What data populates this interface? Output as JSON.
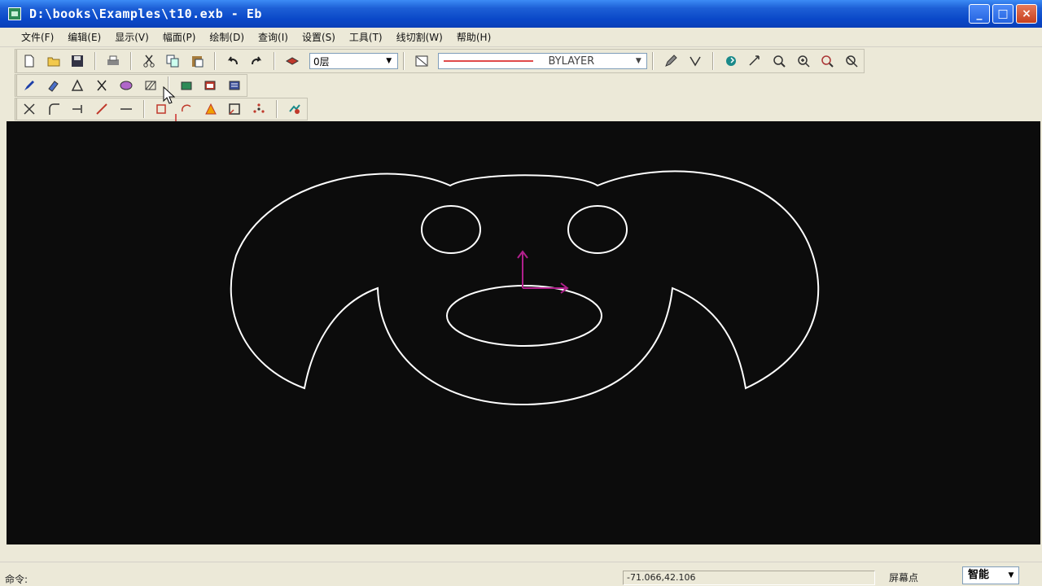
{
  "window": {
    "title": "D:\\books\\Examples\\t10.exb - Eb",
    "buttons": {
      "minimize": "_",
      "maximize": "□",
      "close": "×"
    }
  },
  "menu": {
    "items": [
      "文件(F)",
      "编辑(E)",
      "显示(V)",
      "幅面(P)",
      "绘制(D)",
      "查询(I)",
      "设置(S)",
      "工具(T)",
      "线切割(W)",
      "帮助(H)"
    ]
  },
  "toolbar": {
    "layer_value": "0层",
    "linetype_value": "BYLAYER",
    "line_color": "#e04a4a"
  },
  "canvas": {
    "background": "#0c0c0c",
    "stroke_color": "#ffffff",
    "axis_color": "#b0208c"
  },
  "status": {
    "command_label": "命令:",
    "coordinates": "-71.066,42.106",
    "snap_label": "屏幕点",
    "mode_value": "智能"
  }
}
